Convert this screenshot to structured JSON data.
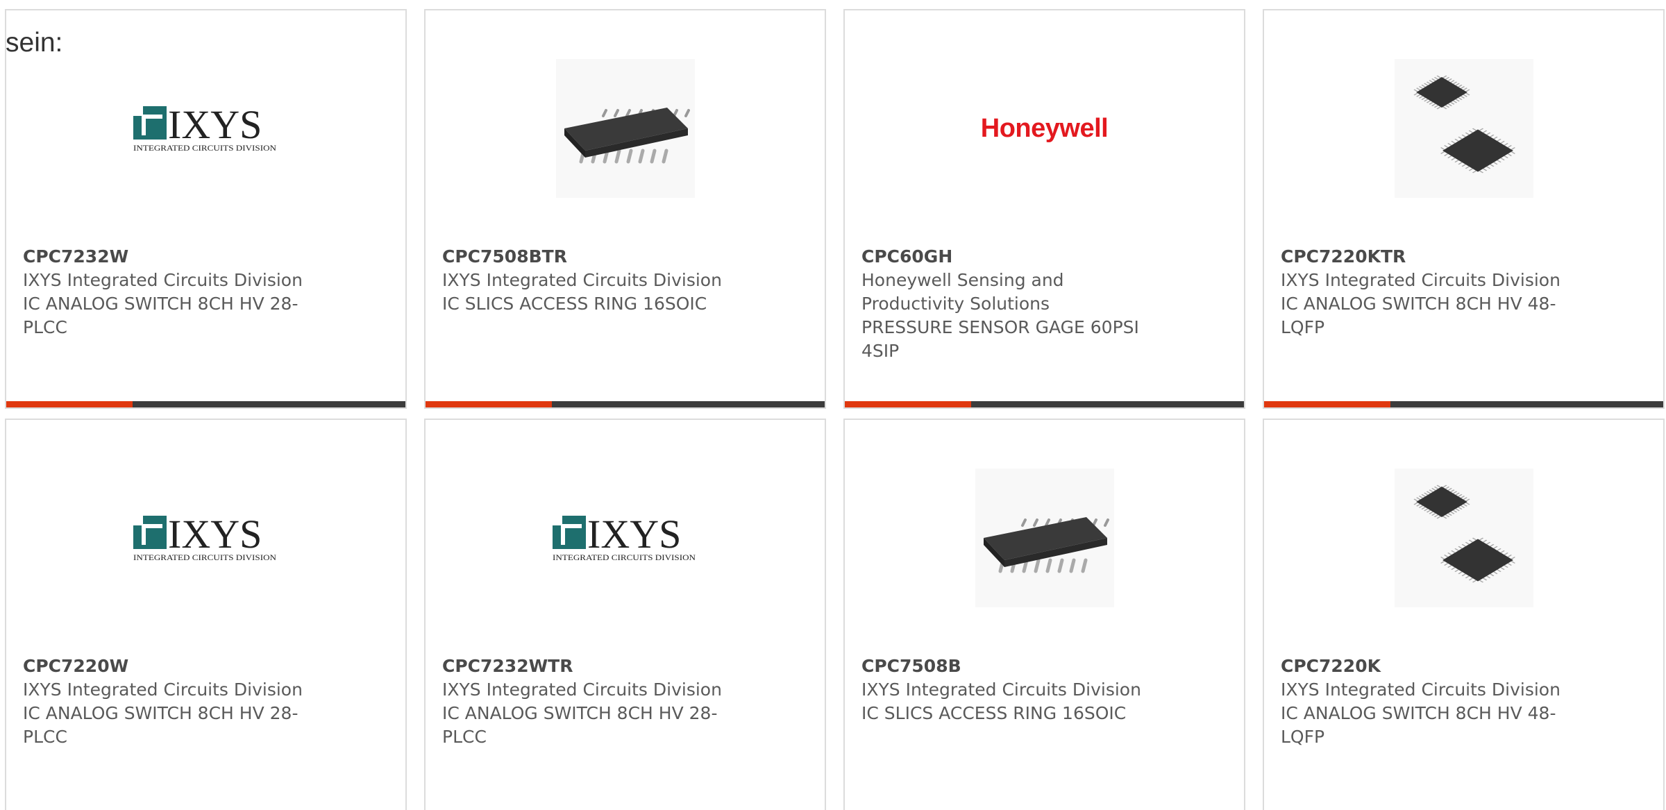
{
  "intro_text": "sein:",
  "colors": {
    "accent": "#e0380f",
    "bar_dark": "#3c3c3c",
    "ixys_teal": "#1e6f6e",
    "honeywell_red": "#e3191f"
  },
  "products": [
    {
      "part_number": "CPC7232W",
      "manufacturer": "IXYS Integrated Circuits Division",
      "description": "IC ANALOG SWITCH 8CH HV 28-PLCC",
      "image": "ixys-logo"
    },
    {
      "part_number": "CPC7508BTR",
      "manufacturer": "IXYS Integrated Circuits Division",
      "description": "IC SLICS ACCESS RING 16SOIC",
      "image": "soic-chip-photo"
    },
    {
      "part_number": "CPC60GH",
      "manufacturer": "Honeywell Sensing and Productivity Solutions",
      "description": "PRESSURE SENSOR GAGE 60PSI 4SIP",
      "image": "honeywell-logo"
    },
    {
      "part_number": "CPC7220KTR",
      "manufacturer": "IXYS Integrated Circuits Division",
      "description": "IC ANALOG SWITCH 8CH HV 48-LQFP",
      "image": "lqfp-chip-photo"
    },
    {
      "part_number": "CPC7220W",
      "manufacturer": "IXYS Integrated Circuits Division",
      "description": "IC ANALOG SWITCH 8CH HV 28-PLCC",
      "image": "ixys-logo"
    },
    {
      "part_number": "CPC7232WTR",
      "manufacturer": "IXYS Integrated Circuits Division",
      "description": "IC ANALOG SWITCH 8CH HV 28-PLCC",
      "image": "ixys-logo"
    },
    {
      "part_number": "CPC7508B",
      "manufacturer": "IXYS Integrated Circuits Division",
      "description": "IC SLICS ACCESS RING 16SOIC",
      "image": "soic-chip-photo"
    },
    {
      "part_number": "CPC7220K",
      "manufacturer": "IXYS Integrated Circuits Division",
      "description": "IC ANALOG SWITCH 8CH HV 48-LQFP",
      "image": "lqfp-chip-photo"
    }
  ],
  "logos": {
    "ixys_wordmark": "IXYS",
    "ixys_tagline": "Integrated Circuits Division",
    "honeywell_wordmark": "Honeywell"
  }
}
